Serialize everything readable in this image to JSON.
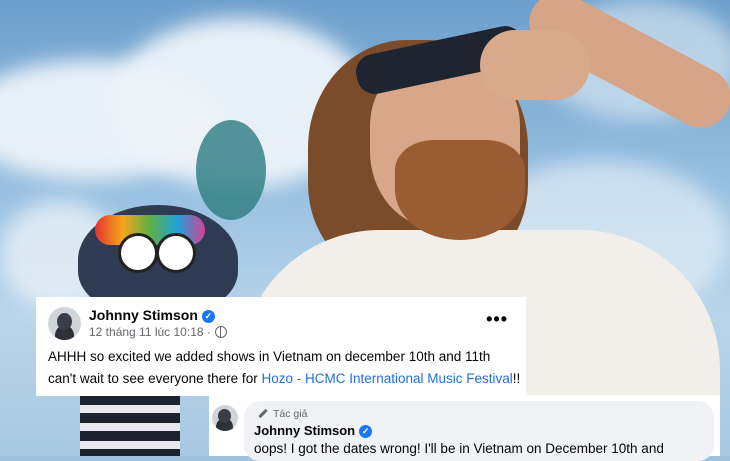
{
  "post": {
    "author": "Johnny Stimson",
    "timestamp": "12 tháng 11 lúc 10:18 ·",
    "line1": "AHHH so excited we added shows in Vietnam on december 10th and 11th",
    "line2_prefix": "can't wait to see everyone there for ",
    "line2_link": "Hozo - HCMC International Music Festival",
    "line2_suffix": "!!",
    "more_label": "•••"
  },
  "comment": {
    "badge": "Tác giả",
    "author": "Johnny Stimson",
    "text": "oops! I got the dates wrong! I'll be in Vietnam on December 10th and"
  },
  "colors": {
    "verified": "#1877f2",
    "link": "#216fdb",
    "bubble": "#f0f2f5"
  },
  "icons": [
    "verified-icon",
    "globe-icon",
    "more-icon",
    "pencil-icon"
  ]
}
